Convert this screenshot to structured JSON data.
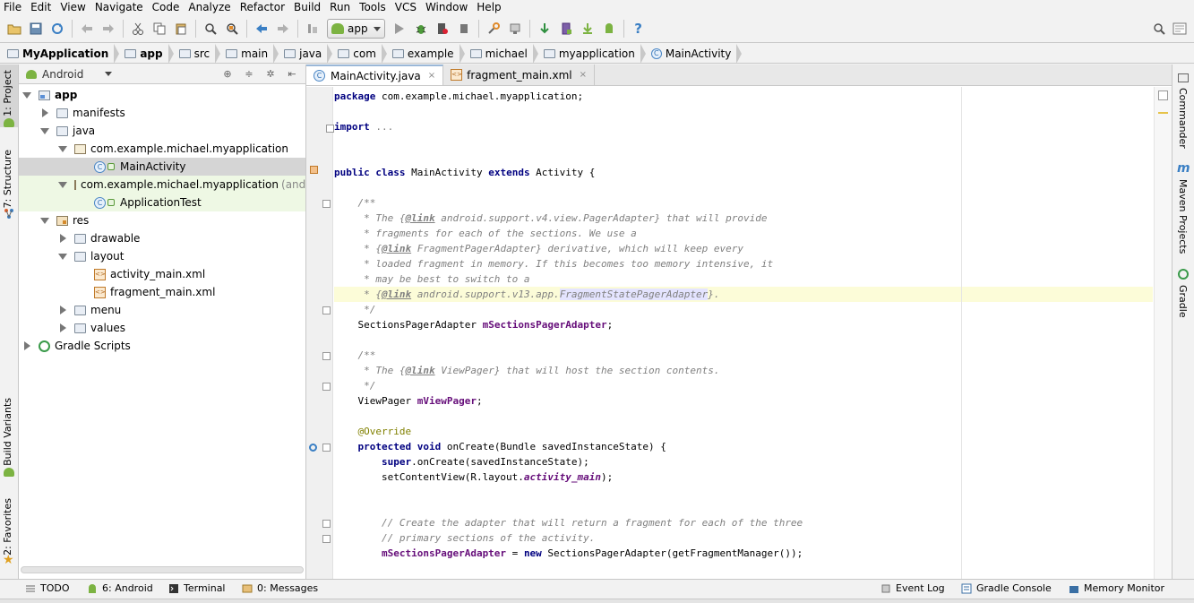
{
  "menu": [
    "File",
    "Edit",
    "View",
    "Navigate",
    "Code",
    "Analyze",
    "Refactor",
    "Build",
    "Run",
    "Tools",
    "VCS",
    "Window",
    "Help"
  ],
  "toolbar": {
    "run_config": "app",
    "help_label": "?"
  },
  "breadcrumb": [
    "MyApplication",
    "app",
    "src",
    "main",
    "java",
    "com",
    "example",
    "michael",
    "myapplication",
    "MainActivity"
  ],
  "left_strip": {
    "project": "1: Project",
    "structure": "7: Structure",
    "build_variants": "Build Variants",
    "favorites": "2: Favorites"
  },
  "right_strip": {
    "commander": "Commander",
    "maven": "Maven Projects",
    "gradle": "Gradle",
    "maven_badge": "m"
  },
  "project_panel": {
    "view_mode": "Android",
    "tree": [
      {
        "label": "app"
      },
      {
        "label": "manifests"
      },
      {
        "label": "java"
      },
      {
        "label": "com.example.michael.myapplication"
      },
      {
        "label": "MainActivity"
      },
      {
        "label": "com.example.michael.myapplication",
        "suffix": "(androidTest)"
      },
      {
        "label": "ApplicationTest"
      },
      {
        "label": "res"
      },
      {
        "label": "drawable"
      },
      {
        "label": "layout"
      },
      {
        "label": "activity_main.xml"
      },
      {
        "label": "fragment_main.xml"
      },
      {
        "label": "menu"
      },
      {
        "label": "values"
      },
      {
        "label": "Gradle Scripts"
      }
    ]
  },
  "editor": {
    "tabs": [
      {
        "label": "MainActivity.java",
        "close": "×"
      },
      {
        "label": "fragment_main.xml",
        "close": "×"
      }
    ],
    "code": {
      "package": "package",
      "package_name": " com.example.michael.myapplication;",
      "import": "import",
      "import_fold": "...",
      "class_public": "public class",
      "class_name": " MainActivity ",
      "class_extends": "extends",
      "class_rest": " Activity {",
      "c1_open": "    /**",
      "c1_l1a": "     * The {",
      "c1_link": "@link",
      "c1_l1b": " android.support.v4.view.PagerAdapter} that will provide",
      "c1_l2": "     * fragments for each of the sections. We use a",
      "c1_l3a": "     * {",
      "c1_l3b": " FragmentPagerAdapter} derivative, which will keep every",
      "c1_l4": "     * loaded fragment in memory. If this becomes too memory intensive, it",
      "c1_l5": "     * may be best to switch to a",
      "c1_l6a": "     * {",
      "c1_l6b": " android.support.v13.app.",
      "c1_l6hl": "FragmentStatePagerAdapter",
      "c1_l6c": "}.",
      "c1_close": "     */",
      "field1_type": "    SectionsPagerAdapter ",
      "field1_name": "mSectionsPagerAdapter",
      "semicolon": ";",
      "c2_open": "    /**",
      "c2_l1a": "     * The {",
      "c2_l1b": " ViewPager} that will host the section contents.",
      "c2_close": "     */",
      "field2_type": "    ViewPager ",
      "field2_name": "mViewPager",
      "annotation": "    @Override",
      "method_kw": "    protected void",
      "method_rest": " onCreate(Bundle savedInstanceState) {",
      "super_kw": "        super",
      "super_rest": ".onCreate(savedInstanceState);",
      "setcv_a": "        setContentView(R.layout.",
      "setcv_field": "activity_main",
      "setcv_b": ");",
      "c3_l1": "        // Create the adapter that will return a fragment for each of the three",
      "c3_l2": "        // primary sections of the activity.",
      "assign_field": "        mSectionsPagerAdapter",
      "assign_eq": " = ",
      "assign_new": "new",
      "assign_rest": " SectionsPagerAdapter(getFragmentManager());"
    }
  },
  "bottom_bar": {
    "todo": "TODO",
    "android": "6: Android",
    "terminal": "Terminal",
    "messages": "0: Messages",
    "event_log": "Event Log",
    "gradle_console": "Gradle Console",
    "memory_monitor": "Memory Monitor"
  },
  "colors": {
    "keyword": "#000080",
    "comment": "#808080",
    "field": "#660e7a",
    "annotation": "#808000",
    "current_line": "#fcfcd8",
    "selection": "#d5d5d5",
    "android_green": "#7cb342"
  }
}
